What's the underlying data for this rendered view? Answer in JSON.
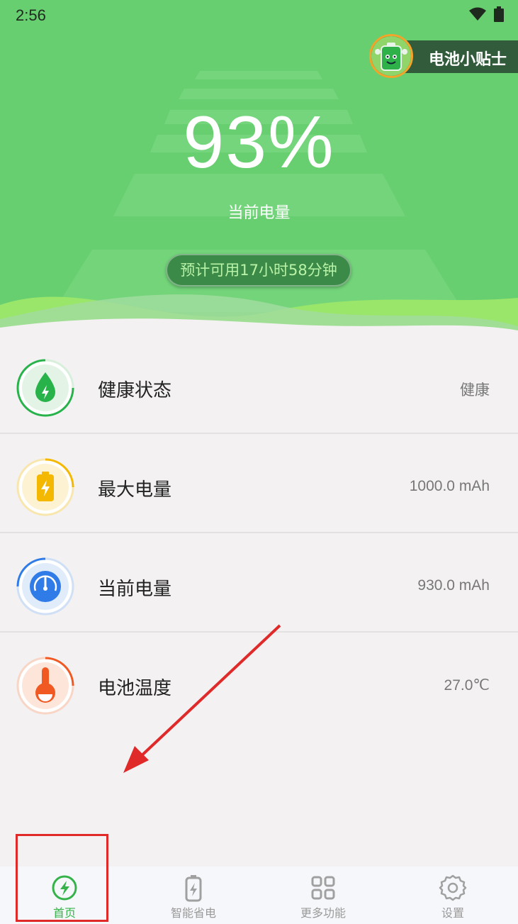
{
  "status_bar": {
    "time": "2:56"
  },
  "header": {
    "tips_label": "电池小贴士",
    "battery_percent": "93%",
    "battery_label": "当前电量",
    "estimate": "预计可用17小时58分钟"
  },
  "items": [
    {
      "label": "健康状态",
      "value": "健康",
      "icon": "drop-bolt-icon",
      "color": "#27b34a"
    },
    {
      "label": "最大电量",
      "value": "1000.0 mAh",
      "icon": "battery-icon",
      "color": "#f5b800"
    },
    {
      "label": "当前电量",
      "value": "930.0 mAh",
      "icon": "gauge-icon",
      "color": "#2f7be8"
    },
    {
      "label": "电池温度",
      "value": "27.0℃",
      "icon": "thermometer-icon",
      "color": "#f05a22"
    }
  ],
  "tabs": [
    {
      "label": "首页",
      "icon": "bolt-circle-icon",
      "active": true
    },
    {
      "label": "智能省电",
      "icon": "battery-bolt-icon",
      "active": false
    },
    {
      "label": "更多功能",
      "icon": "grid-icon",
      "active": false
    },
    {
      "label": "设置",
      "icon": "gear-icon",
      "active": false
    }
  ],
  "colors": {
    "hero_green": "#67cf6f",
    "accent": "#35b34a",
    "annotation": "#e02a2a"
  }
}
